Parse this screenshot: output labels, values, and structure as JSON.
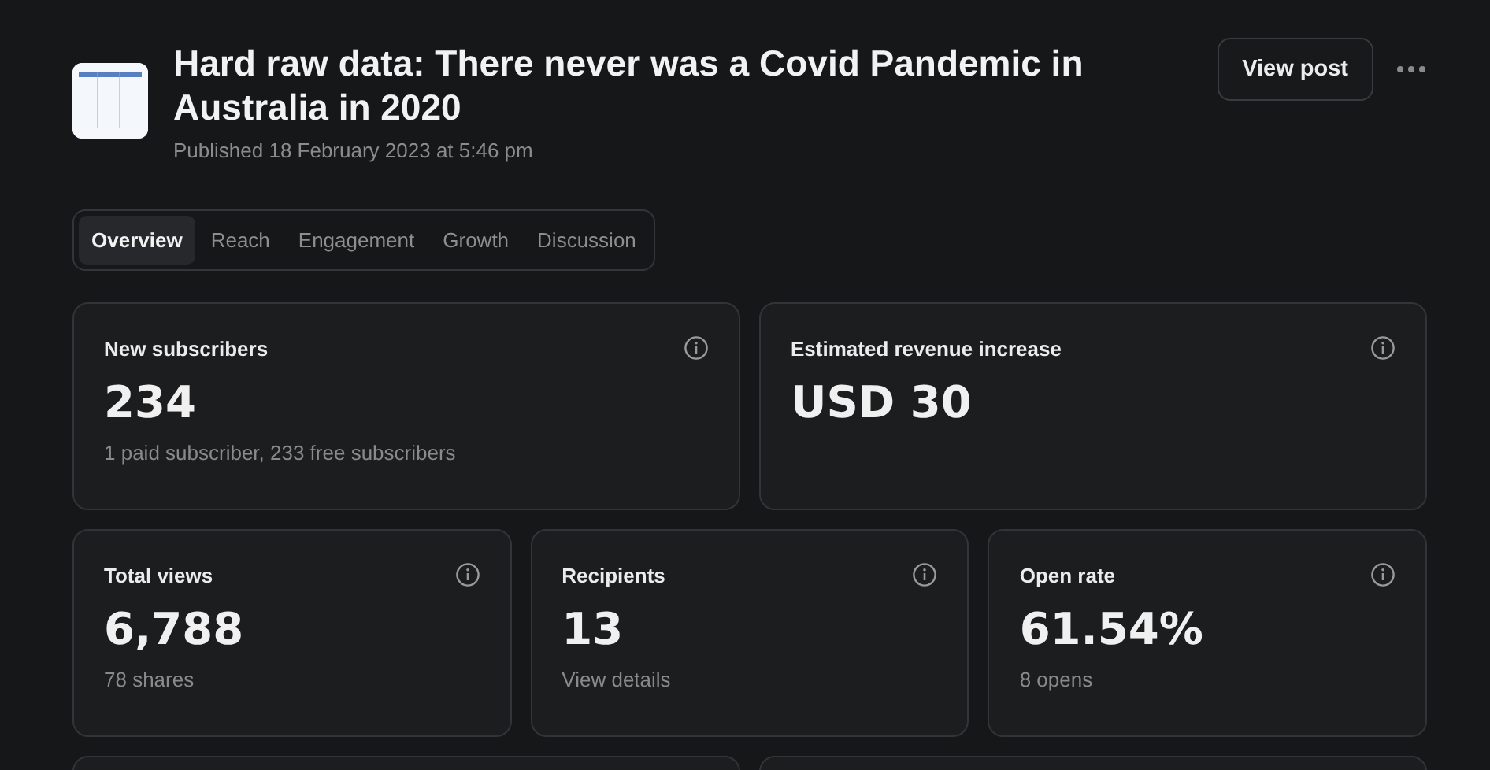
{
  "post": {
    "title": "Hard raw data: There never was a Covid Pandemic in Australia in 2020",
    "published": "Published 18 February 2023 at 5:46 pm"
  },
  "actions": {
    "view_post": "View post"
  },
  "tabs": [
    {
      "label": "Overview",
      "selected": true
    },
    {
      "label": "Reach",
      "selected": false
    },
    {
      "label": "Engagement",
      "selected": false
    },
    {
      "label": "Growth",
      "selected": false
    },
    {
      "label": "Discussion",
      "selected": false
    }
  ],
  "top_stats": [
    {
      "label": "New subscribers",
      "value": "234",
      "detail": "1 paid subscriber, 233 free subscribers"
    },
    {
      "label": "Estimated revenue increase",
      "value": "USD 30"
    }
  ],
  "stats": [
    {
      "label": "Total views",
      "value": "6,788",
      "detail": "78 shares"
    },
    {
      "label": "Recipients",
      "value": "13",
      "detail": "View details"
    },
    {
      "label": "Open rate",
      "value": "61.54%",
      "detail": "8 opens"
    }
  ]
}
